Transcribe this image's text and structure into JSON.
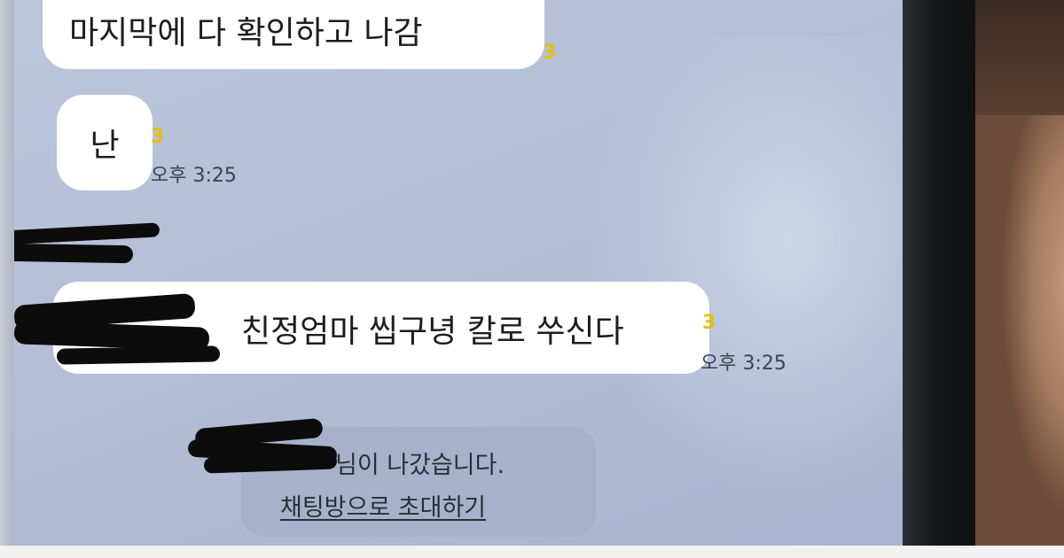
{
  "chat": {
    "messages": [
      {
        "text": "마지막에 다 확인하고 나감",
        "unread": "3"
      },
      {
        "text": "난",
        "unread": "3",
        "time": "오후 3:25"
      },
      {
        "text": "친정엄마 씹구녕 칼로 쑤신다",
        "unread": "3",
        "time": "오후 3:25"
      }
    ],
    "system": {
      "left_message": "님이 나갔습니다.",
      "invite_link": "채팅방으로 초대하기"
    }
  },
  "colors": {
    "background": "#b4bfd6",
    "bubble": "#ffffff",
    "unread": "#e5c10d"
  }
}
